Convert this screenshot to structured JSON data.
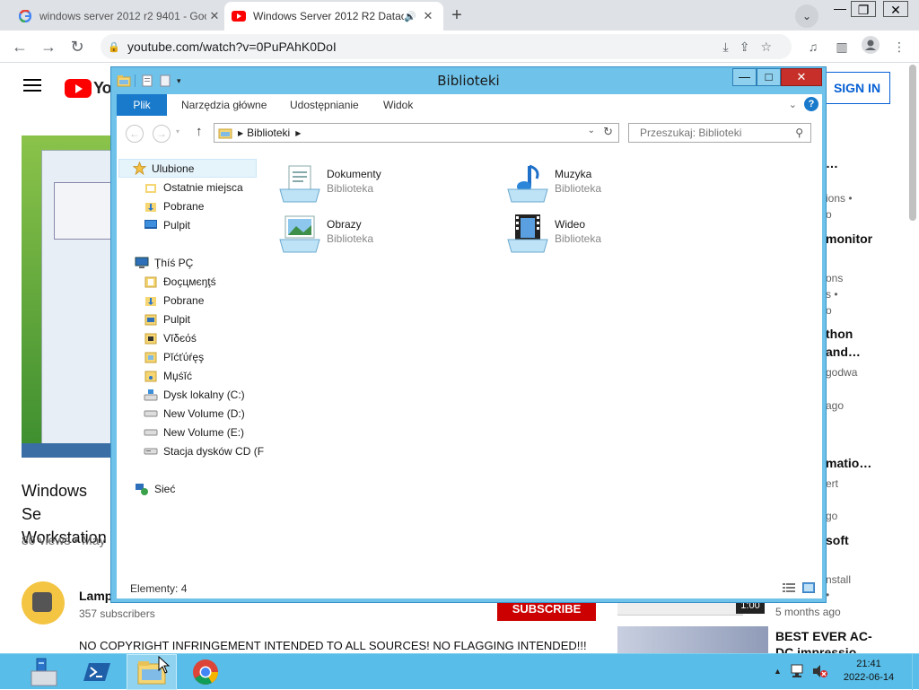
{
  "browser": {
    "tabs": [
      {
        "title": "windows server 2012 r2 9401 - Google",
        "favicon": "google-icon",
        "active": false
      },
      {
        "title": "Windows Server 2012 R2 Datacenter",
        "favicon": "youtube-icon",
        "active": true
      }
    ],
    "url": "youtube.com/watch?v=0PuPAhK0DoI"
  },
  "youtube": {
    "logo": "Yo",
    "signin": "SIGN IN",
    "video_title": "Windows Se... Workstation",
    "video_title_l1": "Windows Se",
    "video_title_l2": "Workstation",
    "meta": "80 views • May",
    "channel": "Lamp",
    "subscribers": "357 subscribers",
    "subscribe": "SUBSCRIBE",
    "description": "NO COPYRIGHT INFRINGEMENT INTENDED TO ALL SOURCES! NO FLAGGING INTENDED!!!",
    "sidebar": [
      {
        "text": "…",
        "kind": "t"
      },
      {
        "text": "ions •",
        "kind": "m"
      },
      {
        "text": "o",
        "kind": "m"
      },
      {
        "text": "monitor",
        "kind": "t"
      },
      {
        "text": "ons",
        "kind": "m"
      },
      {
        "text": "s •",
        "kind": "m"
      },
      {
        "text": "o",
        "kind": "m"
      },
      {
        "text": "thon",
        "kind": "t"
      },
      {
        "text": "and…",
        "kind": "t"
      },
      {
        "text": "godwa",
        "kind": "m"
      },
      {
        "text": "ago",
        "kind": "m"
      },
      {
        "text": "matio…",
        "kind": "t"
      },
      {
        "text": "ert",
        "kind": "m"
      },
      {
        "text": "go",
        "kind": "m"
      },
      {
        "text": "soft",
        "kind": "t"
      },
      {
        "text": "nstall",
        "kind": "m"
      },
      {
        "text": "•",
        "kind": "m"
      }
    ],
    "duration": "1:00",
    "ago": "5 months ago",
    "next_title_l1": "BEST EVER AC-",
    "next_title_l2": "DC impressio"
  },
  "explorer": {
    "title": "Biblioteki",
    "ribbon_tabs": [
      "Plik",
      "Narzędzia główne",
      "Udostępnianie",
      "Widok"
    ],
    "address": "Biblioteki",
    "search_placeholder": "Przeszukaj: Biblioteki",
    "nav": [
      {
        "label": "Ulubione",
        "icon": "star-icon",
        "indent": 0,
        "selected": true
      },
      {
        "label": "Ostatnie miejsca",
        "icon": "recent-places-icon",
        "indent": 1
      },
      {
        "label": "Pobrane",
        "icon": "downloads-icon",
        "indent": 1
      },
      {
        "label": "Pulpit",
        "icon": "desktop-icon",
        "indent": 1
      },
      {
        "label": "Ţhíś PÇ",
        "icon": "computer-icon",
        "indent": 0
      },
      {
        "label": "Ðоçцмєŋţś",
        "icon": "folder-icon",
        "indent": 1
      },
      {
        "label": "Pobrane",
        "icon": "downloads-icon",
        "indent": 1
      },
      {
        "label": "Pulpit",
        "icon": "desktop-icon",
        "indent": 1
      },
      {
        "label": "Vĭδєόś",
        "icon": "folder-icon",
        "indent": 1
      },
      {
        "label": "Pĭćťύŕęş",
        "icon": "folder-icon",
        "indent": 1
      },
      {
        "label": "Mџśĭć",
        "icon": "folder-icon",
        "indent": 1
      },
      {
        "label": "Dysk lokalny (C:)",
        "icon": "drive-icon",
        "indent": 1
      },
      {
        "label": "New Volume (D:)",
        "icon": "drive-icon",
        "indent": 1
      },
      {
        "label": "New Volume (E:)",
        "icon": "drive-icon",
        "indent": 1
      },
      {
        "label": "Stacja dysków CD (F",
        "icon": "cd-drive-icon",
        "indent": 1
      },
      {
        "label": "Sieć",
        "icon": "network-icon",
        "indent": 0
      }
    ],
    "libraries": [
      {
        "name": "Dokumenty",
        "type": "Biblioteka",
        "icon": "documents-library-icon"
      },
      {
        "name": "Muzyka",
        "type": "Biblioteka",
        "icon": "music-library-icon"
      },
      {
        "name": "Obrazy",
        "type": "Biblioteka",
        "icon": "pictures-library-icon"
      },
      {
        "name": "Wideo",
        "type": "Biblioteka",
        "icon": "videos-library-icon"
      }
    ],
    "status": "Elementy: 4"
  },
  "taskbar": {
    "time": "21:41",
    "date": "2022-06-14"
  },
  "colors": {
    "window_frame": "#6fc2e9",
    "ribbon_file": "#1979ca",
    "close_button": "#c7302a",
    "taskbar": "#58bde8",
    "youtube_red": "#ff0000"
  }
}
